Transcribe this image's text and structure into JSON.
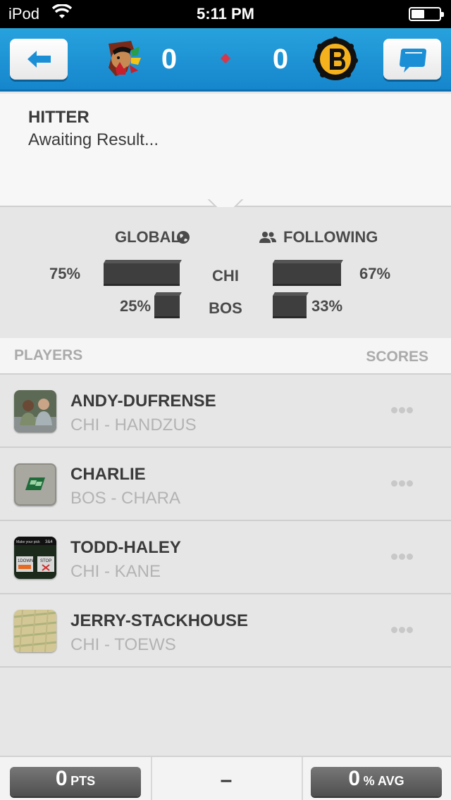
{
  "status_bar": {
    "carrier": "iPod",
    "time": "5:11 PM"
  },
  "header": {
    "home_score": "0",
    "away_score": "0",
    "home_team_icon": "chicago-blackhawks-logo",
    "away_team_icon": "boston-bruins-logo",
    "accent_color": "#1a90d4"
  },
  "hitter": {
    "title": "HITTER",
    "status": "Awaiting Result..."
  },
  "stats": {
    "global_label": "GLOBAL",
    "following_label": "FOLLOWING",
    "rows": [
      {
        "team": "CHI",
        "global_pct": 75,
        "global_text": "75%",
        "following_pct": 67,
        "following_text": "67%"
      },
      {
        "team": "BOS",
        "global_pct": 25,
        "global_text": "25%",
        "following_pct": 33,
        "following_text": "33%"
      }
    ]
  },
  "list": {
    "players_header": "PLAYERS",
    "scores_header": "SCORES",
    "players": [
      {
        "name": "ANDY-DUFRENSE",
        "team": "CHI - HANDZUS"
      },
      {
        "name": "CHARLIE",
        "team": "BOS - CHARA"
      },
      {
        "name": "TODD-HALEY",
        "team": "CHI - KANE"
      },
      {
        "name": "JERRY-STACKHOUSE",
        "team": "CHI - TOEWS"
      }
    ]
  },
  "avatar3": {
    "caption_left": "Make your pick",
    "caption_right": "3&4",
    "btn_left": "1DOWN",
    "btn_right": "STOP"
  },
  "footer": {
    "pts_value": "0",
    "pts_unit": "PTS",
    "middle": "–",
    "avg_value": "0",
    "avg_unit": "% AVG"
  }
}
